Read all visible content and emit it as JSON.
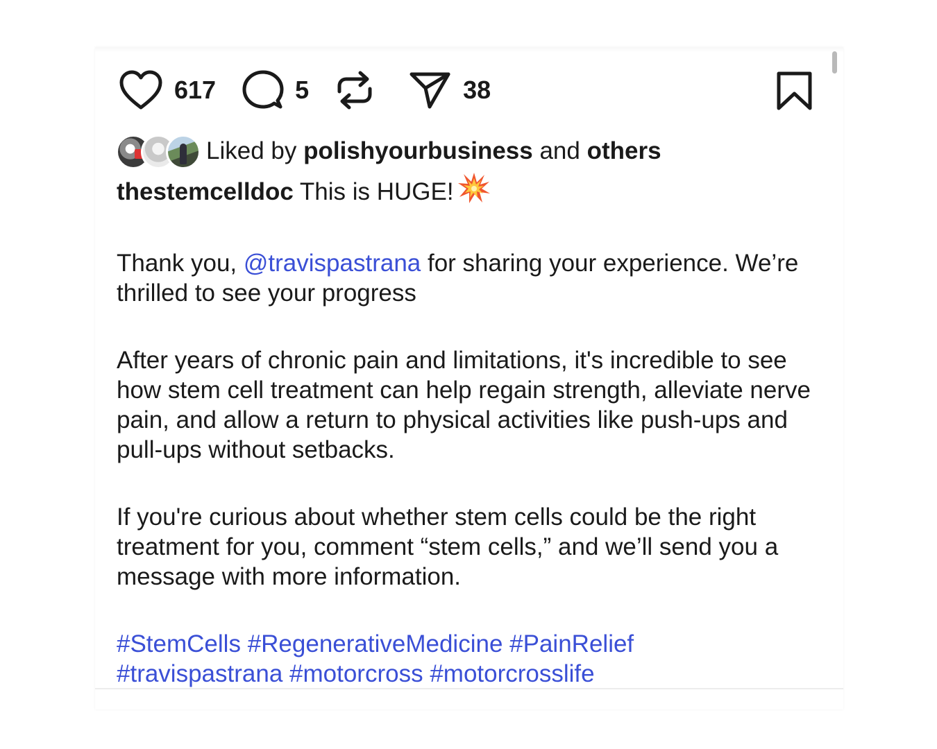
{
  "actions": {
    "like_count": "617",
    "comment_count": "5",
    "share_count": "38"
  },
  "likes": {
    "prefix": "Liked by",
    "first_user": "polishyourbusiness",
    "conjunction": "and",
    "others": "others"
  },
  "caption": {
    "username": "thestemcelldoc",
    "headline": "This is HUGE!",
    "emoji": "collision-emoji",
    "p1_before": "Thank you,",
    "mention": "@travispastrana",
    "p1_after": "for sharing your experience. We’re thrilled to see your progress",
    "p2": "After years of chronic pain and limitations, it's incredible to see how stem cell treatment can help regain strength, alleviate nerve pain, and allow a return to physical activities like push-ups and pull-ups without setbacks.",
    "p3": "If you're curious about whether stem cells could be the right treatment for you, comment “stem cells,” and we’ll send you a message with more information.",
    "hashtags": [
      "#StemCells",
      "#RegenerativeMedicine",
      "#PainRelief",
      "#travispastrana",
      "#motorcross",
      "#motorcrosslife"
    ]
  },
  "colors": {
    "link": "#3a4fd6",
    "text": "#1a1a1a",
    "icon": "#1a1a1a"
  },
  "icons": [
    "heart-icon",
    "comment-icon",
    "repost-icon",
    "send-icon",
    "bookmark-icon"
  ]
}
